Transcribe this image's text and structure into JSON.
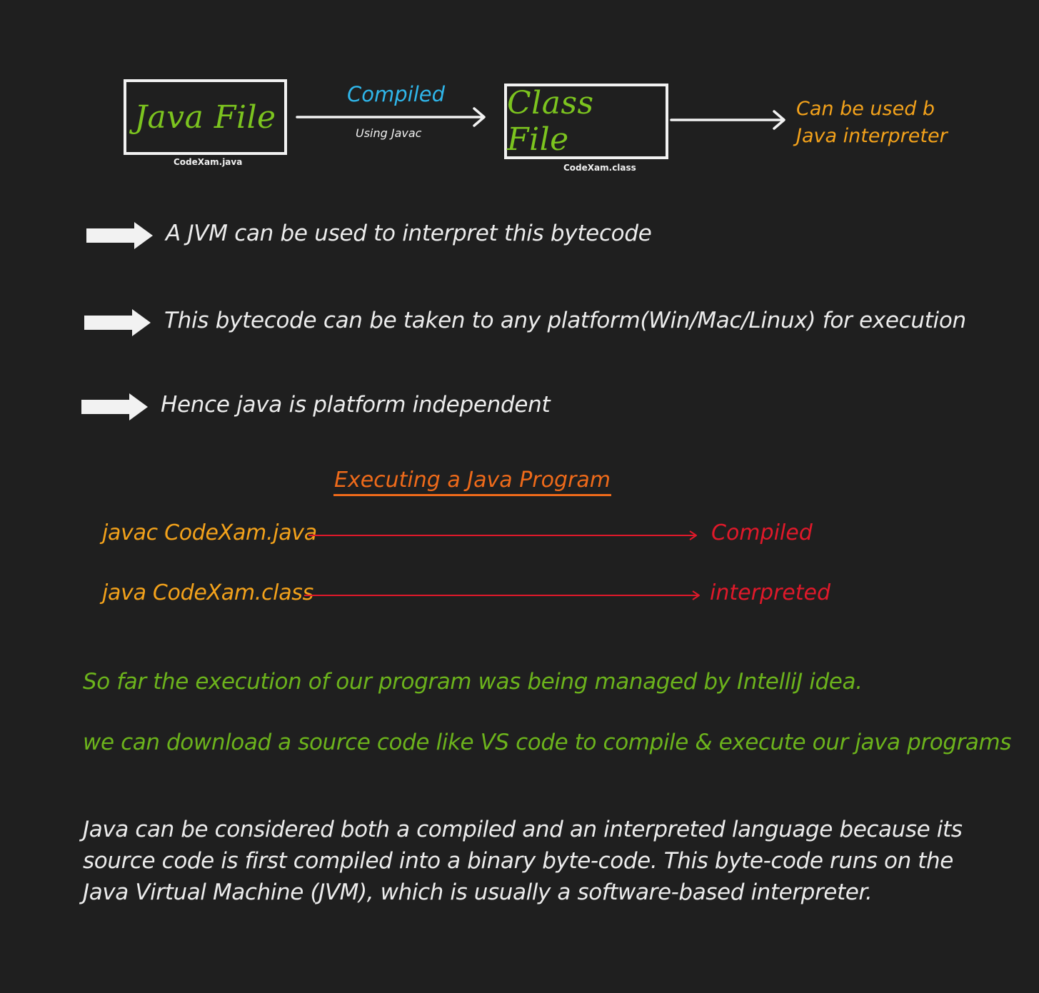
{
  "diagram": {
    "java_file": {
      "label": "Java File",
      "caption": "CodeXam.java"
    },
    "compile_arrow": {
      "label": "Compiled",
      "sublabel": "Using Javac"
    },
    "class_file": {
      "label": "Class File",
      "caption": "CodeXam.class"
    },
    "interpreter_note": [
      "Can be used b",
      "Java interpreter"
    ]
  },
  "bullets": [
    "A JVM can be used to interpret this bytecode",
    "This bytecode can be taken to any platform(Win/Mac/Linux) for execution",
    "Hence java is platform independent"
  ],
  "executing": {
    "title": "Executing a Java Program",
    "rows": [
      {
        "command": "javac CodeXam.java",
        "result": "Compiled"
      },
      {
        "command": "java CodeXam.class",
        "result": "interpreted"
      }
    ]
  },
  "notes": [
    "So far the execution of our program was being managed by IntelliJ idea.",
    "we can download a source code like VS code to compile & execute our java programs"
  ],
  "paragraph": [
    "Java can be considered both a compiled and an interpreted language because its",
    "source code is first compiled into a binary byte-code. This byte-code runs on the",
    "Java Virtual Machine (JVM), which is usually a software-based interpreter."
  ],
  "colors": {
    "background": "#1f1f1f",
    "box_label_green": "#7cc41f",
    "compiled_blue": "#2fb6ea",
    "orange": "#f3a21b",
    "title_orange": "#ee6a1a",
    "red": "#e0192a",
    "note_green": "#6cb31c",
    "white": "#ececec"
  },
  "icons": [
    "right-arrow-icon",
    "block-arrow-icon"
  ]
}
